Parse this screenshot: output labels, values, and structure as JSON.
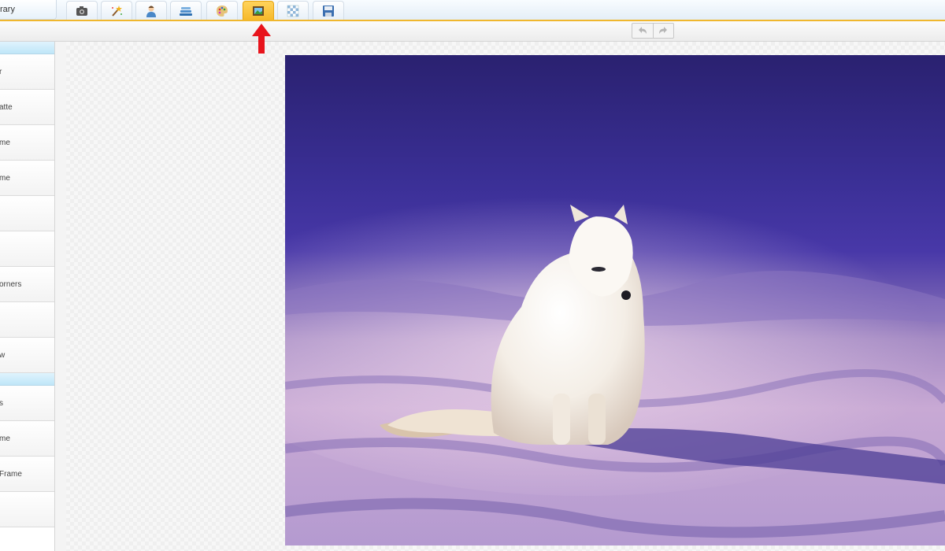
{
  "toolbar": {
    "library_label": "rary",
    "tools": [
      {
        "name": "camera-icon"
      },
      {
        "name": "magic-wand-icon"
      },
      {
        "name": "person-icon"
      },
      {
        "name": "layers-icon"
      },
      {
        "name": "palette-icon"
      },
      {
        "name": "frame-icon",
        "active": true
      },
      {
        "name": "checkerboard-icon"
      },
      {
        "name": "save-icon"
      }
    ],
    "active_color": "#f6b92a"
  },
  "history": {
    "undo_icon": "undo-icon",
    "redo_icon": "redo-icon"
  },
  "sidebar": {
    "items": [
      {
        "label": "r"
      },
      {
        "label": "atte"
      },
      {
        "label": "me"
      },
      {
        "label": "me"
      },
      {
        "label": ""
      },
      {
        "label": ""
      },
      {
        "label": "orners"
      },
      {
        "label": ""
      },
      {
        "label": "w"
      },
      {
        "label": "s"
      },
      {
        "label": "me"
      },
      {
        "label": "Frame"
      },
      {
        "label": ""
      }
    ]
  },
  "canvas": {
    "image_subject": "arctic-fox-photo"
  },
  "annotation": {
    "arrow_color": "#e8141c"
  }
}
